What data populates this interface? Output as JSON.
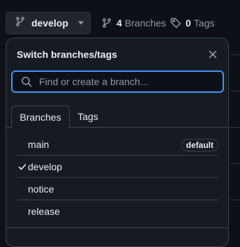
{
  "toolbar": {
    "current_branch": "develop",
    "branches_count": "4",
    "branches_label": "Branches",
    "tags_count": "0",
    "tags_label": "Tags"
  },
  "dropdown": {
    "title": "Switch branches/tags",
    "search_placeholder": "Find or create a branch...",
    "search_value": "",
    "tabs": [
      {
        "label": "Branches",
        "active": true
      },
      {
        "label": "Tags",
        "active": false
      }
    ],
    "branches": [
      {
        "name": "main",
        "badge": "default",
        "selected": false
      },
      {
        "name": "develop",
        "badge": "",
        "selected": true
      },
      {
        "name": "notice",
        "badge": "",
        "selected": false
      },
      {
        "name": "release",
        "badge": "",
        "selected": false
      }
    ]
  },
  "icons": {
    "branch": "git-branch-icon",
    "caret": "triangle-down-icon",
    "tag": "tag-icon",
    "close": "x-icon",
    "search": "search-icon",
    "check": "check-icon"
  },
  "colors": {
    "background": "#0d1117",
    "panel": "#161b22",
    "border": "#3d444d",
    "focus": "#4493f8",
    "text": "#e6edf3",
    "muted": "#9198a1"
  }
}
